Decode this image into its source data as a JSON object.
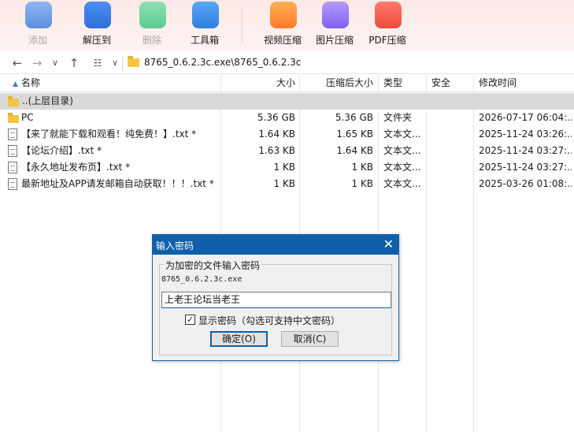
{
  "toolbar": {
    "add": "添加",
    "extract": "解压到",
    "delete": "删除",
    "tools": "工具箱",
    "video": "视频压缩",
    "image": "图片压缩",
    "pdf": "PDF压缩"
  },
  "address": {
    "path": "8765_0.6.2.3c.exe\\8765_0.6.2.3c"
  },
  "columns": {
    "name": "名称",
    "size": "大小",
    "packed": "压缩后大小",
    "type": "类型",
    "security": "安全",
    "modified": "修改时间"
  },
  "rows": [
    {
      "name": "..(上层目录)",
      "size": "",
      "packed": "",
      "type": "",
      "security": "",
      "modified": ""
    },
    {
      "name": "PC",
      "size": "5.36 GB",
      "packed": "5.36 GB",
      "type": "文件夹",
      "security": "",
      "modified": "2026-07-17 06:04:..."
    },
    {
      "name": "【来了就能下载和观看！纯免费！】.txt *",
      "size": "1.64 KB",
      "packed": "1.65 KB",
      "type": "文本文...",
      "security": "",
      "modified": "2025-11-24 03:26:..."
    },
    {
      "name": "【论坛介绍】.txt *",
      "size": "1.63 KB",
      "packed": "1.64 KB",
      "type": "文本文...",
      "security": "",
      "modified": "2025-11-24 03:27:..."
    },
    {
      "name": "【永久地址发布页】.txt *",
      "size": "1 KB",
      "packed": "1 KB",
      "type": "文本文...",
      "security": "",
      "modified": "2025-11-24 03:27:..."
    },
    {
      "name": "最新地址及APP请发邮箱自动获取！！！.txt *",
      "size": "1 KB",
      "packed": "1 KB",
      "type": "文本文...",
      "security": "",
      "modified": "2025-03-26 01:08:..."
    }
  ],
  "dialog": {
    "title": "输入密码",
    "close": "✕",
    "group_label": "为加密的文件输入密码",
    "filename": "8765_0.6.2.3c.exe",
    "password": "上老王论坛当老王",
    "show_password": "显示密码（勾选可支持中文密码）",
    "check_mark": "✓",
    "ok": "确定(O)",
    "cancel": "取消(C)"
  }
}
